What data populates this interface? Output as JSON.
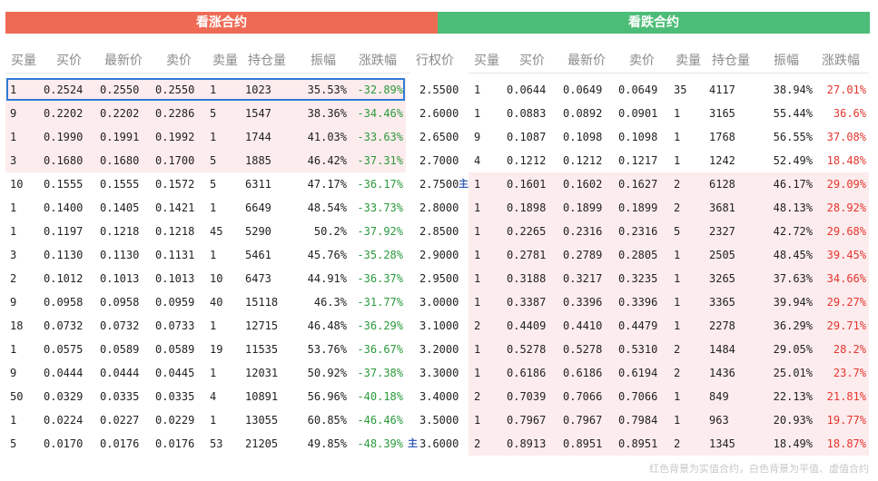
{
  "header": {
    "call_title": "看涨合约",
    "put_title": "看跌合约"
  },
  "columns": {
    "call": [
      "买量",
      "买价",
      "最新价",
      "卖价",
      "卖量",
      "持仓量",
      "振幅",
      "涨跌幅"
    ],
    "strike": "行权价",
    "put": [
      "买量",
      "买价",
      "最新价",
      "卖价",
      "卖量",
      "持仓量",
      "振幅",
      "涨跌幅"
    ]
  },
  "main_tag": "主",
  "footer_note": "红色背景为实值合约，白色背景为平值、虚值合约",
  "rows": [
    {
      "strike": "2.5500",
      "call": {
        "bid_vol": "1",
        "bid": "0.2524",
        "last": "0.2550",
        "ask": "0.2550",
        "ask_vol": "1",
        "oi": "1023",
        "amp": "35.53%",
        "chg": "-32.89%",
        "itm": true
      },
      "put": {
        "bid_vol": "1",
        "bid": "0.0644",
        "last": "0.0649",
        "ask": "0.0649",
        "ask_vol": "35",
        "oi": "4117",
        "amp": "38.94%",
        "chg": "27.01%",
        "itm": false
      }
    },
    {
      "strike": "2.6000",
      "call": {
        "bid_vol": "9",
        "bid": "0.2202",
        "last": "0.2202",
        "ask": "0.2286",
        "ask_vol": "5",
        "oi": "1547",
        "amp": "38.36%",
        "chg": "-34.46%",
        "itm": true
      },
      "put": {
        "bid_vol": "1",
        "bid": "0.0883",
        "last": "0.0892",
        "ask": "0.0901",
        "ask_vol": "1",
        "oi": "3165",
        "amp": "55.44%",
        "chg": "36.6%",
        "itm": false
      }
    },
    {
      "strike": "2.6500",
      "call": {
        "bid_vol": "1",
        "bid": "0.1990",
        "last": "0.1991",
        "ask": "0.1992",
        "ask_vol": "1",
        "oi": "1744",
        "amp": "41.03%",
        "chg": "-33.63%",
        "itm": true
      },
      "put": {
        "bid_vol": "9",
        "bid": "0.1087",
        "last": "0.1098",
        "ask": "0.1098",
        "ask_vol": "1",
        "oi": "1768",
        "amp": "56.55%",
        "chg": "37.08%",
        "itm": false
      }
    },
    {
      "strike": "2.7000",
      "call": {
        "bid_vol": "3",
        "bid": "0.1680",
        "last": "0.1680",
        "ask": "0.1700",
        "ask_vol": "5",
        "oi": "1885",
        "amp": "46.42%",
        "chg": "-37.31%",
        "itm": true
      },
      "put": {
        "bid_vol": "4",
        "bid": "0.1212",
        "last": "0.1212",
        "ask": "0.1217",
        "ask_vol": "1",
        "oi": "1242",
        "amp": "52.49%",
        "chg": "18.48%",
        "itm": false
      }
    },
    {
      "strike": "2.7500",
      "call": {
        "bid_vol": "10",
        "bid": "0.1555",
        "last": "0.1555",
        "ask": "0.1572",
        "ask_vol": "5",
        "oi": "6311",
        "amp": "47.17%",
        "chg": "-36.17%",
        "itm": false
      },
      "put": {
        "bid_vol": "1",
        "bid": "0.1601",
        "last": "0.1602",
        "ask": "0.1627",
        "ask_vol": "2",
        "oi": "6128",
        "amp": "46.17%",
        "chg": "29.09%",
        "itm": true
      }
    },
    {
      "strike": "2.8000",
      "call": {
        "bid_vol": "1",
        "bid": "0.1400",
        "last": "0.1405",
        "ask": "0.1421",
        "ask_vol": "1",
        "oi": "6649",
        "amp": "48.54%",
        "chg": "-33.73%",
        "itm": false
      },
      "put": {
        "bid_vol": "1",
        "bid": "0.1898",
        "last": "0.1899",
        "ask": "0.1899",
        "ask_vol": "2",
        "oi": "3681",
        "amp": "48.13%",
        "chg": "28.92%",
        "itm": true
      }
    },
    {
      "strike": "2.8500",
      "call": {
        "bid_vol": "1",
        "bid": "0.1197",
        "last": "0.1218",
        "ask": "0.1218",
        "ask_vol": "45",
        "oi": "5290",
        "amp": "50.2%",
        "chg": "-37.92%",
        "itm": false
      },
      "put": {
        "bid_vol": "1",
        "bid": "0.2265",
        "last": "0.2316",
        "ask": "0.2316",
        "ask_vol": "5",
        "oi": "2327",
        "amp": "42.72%",
        "chg": "29.68%",
        "itm": true
      }
    },
    {
      "strike": "2.9000",
      "call": {
        "bid_vol": "3",
        "bid": "0.1130",
        "last": "0.1130",
        "ask": "0.1131",
        "ask_vol": "1",
        "oi": "5461",
        "amp": "45.76%",
        "chg": "-35.28%",
        "itm": false
      },
      "put": {
        "bid_vol": "1",
        "bid": "0.2781",
        "last": "0.2789",
        "ask": "0.2805",
        "ask_vol": "1",
        "oi": "2505",
        "amp": "48.45%",
        "chg": "39.45%",
        "itm": true
      }
    },
    {
      "strike": "2.9500",
      "call": {
        "bid_vol": "2",
        "bid": "0.1012",
        "last": "0.1013",
        "ask": "0.1013",
        "ask_vol": "10",
        "oi": "6473",
        "amp": "44.91%",
        "chg": "-36.37%",
        "itm": false
      },
      "put": {
        "bid_vol": "1",
        "bid": "0.3188",
        "last": "0.3217",
        "ask": "0.3235",
        "ask_vol": "1",
        "oi": "3265",
        "amp": "37.63%",
        "chg": "34.66%",
        "itm": true
      }
    },
    {
      "strike": "3.0000",
      "call": {
        "bid_vol": "9",
        "bid": "0.0958",
        "last": "0.0958",
        "ask": "0.0959",
        "ask_vol": "40",
        "oi": "15118",
        "amp": "46.3%",
        "chg": "-31.77%",
        "itm": false
      },
      "put": {
        "bid_vol": "1",
        "bid": "0.3387",
        "last": "0.3396",
        "ask": "0.3396",
        "ask_vol": "1",
        "oi": "3365",
        "amp": "39.94%",
        "chg": "29.27%",
        "itm": true
      }
    },
    {
      "strike": "3.1000",
      "call": {
        "bid_vol": "18",
        "bid": "0.0732",
        "last": "0.0732",
        "ask": "0.0733",
        "ask_vol": "1",
        "oi": "12715",
        "amp": "46.48%",
        "chg": "-36.29%",
        "itm": false
      },
      "put": {
        "bid_vol": "2",
        "bid": "0.4409",
        "last": "0.4410",
        "ask": "0.4479",
        "ask_vol": "1",
        "oi": "2278",
        "amp": "36.29%",
        "chg": "29.71%",
        "itm": true
      }
    },
    {
      "strike": "3.2000",
      "call": {
        "bid_vol": "1",
        "bid": "0.0575",
        "last": "0.0589",
        "ask": "0.0589",
        "ask_vol": "19",
        "oi": "11535",
        "amp": "53.76%",
        "chg": "-36.67%",
        "itm": false
      },
      "put": {
        "bid_vol": "1",
        "bid": "0.5278",
        "last": "0.5278",
        "ask": "0.5310",
        "ask_vol": "2",
        "oi": "1484",
        "amp": "29.05%",
        "chg": "28.2%",
        "itm": true
      }
    },
    {
      "strike": "3.3000",
      "call": {
        "bid_vol": "9",
        "bid": "0.0444",
        "last": "0.0444",
        "ask": "0.0445",
        "ask_vol": "1",
        "oi": "12031",
        "amp": "50.92%",
        "chg": "-37.38%",
        "itm": false
      },
      "put": {
        "bid_vol": "1",
        "bid": "0.6186",
        "last": "0.6186",
        "ask": "0.6194",
        "ask_vol": "2",
        "oi": "1436",
        "amp": "25.01%",
        "chg": "23.7%",
        "itm": true
      }
    },
    {
      "strike": "3.4000",
      "call": {
        "bid_vol": "50",
        "bid": "0.0329",
        "last": "0.0335",
        "ask": "0.0335",
        "ask_vol": "4",
        "oi": "10891",
        "amp": "56.96%",
        "chg": "-40.18%",
        "itm": false
      },
      "put": {
        "bid_vol": "2",
        "bid": "0.7039",
        "last": "0.7066",
        "ask": "0.7066",
        "ask_vol": "1",
        "oi": "849",
        "amp": "22.13%",
        "chg": "21.81%",
        "itm": true
      }
    },
    {
      "strike": "3.5000",
      "call": {
        "bid_vol": "1",
        "bid": "0.0224",
        "last": "0.0227",
        "ask": "0.0229",
        "ask_vol": "1",
        "oi": "13055",
        "amp": "60.85%",
        "chg": "-46.46%",
        "itm": false
      },
      "put": {
        "bid_vol": "1",
        "bid": "0.7967",
        "last": "0.7967",
        "ask": "0.7984",
        "ask_vol": "1",
        "oi": "963",
        "amp": "20.93%",
        "chg": "19.77%",
        "itm": true
      }
    },
    {
      "strike": "3.6000",
      "call": {
        "bid_vol": "5",
        "bid": "0.0170",
        "last": "0.0176",
        "ask": "0.0176",
        "ask_vol": "53",
        "oi": "21205",
        "amp": "49.85%",
        "chg": "-48.39%",
        "itm": false
      },
      "put": {
        "bid_vol": "2",
        "bid": "0.8913",
        "last": "0.8951",
        "ask": "0.8951",
        "ask_vol": "2",
        "oi": "1345",
        "amp": "18.49%",
        "chg": "18.87%",
        "itm": true
      }
    }
  ],
  "main_rows": [
    {
      "row": 4,
      "side": "put"
    },
    {
      "row": 15,
      "side": "call"
    }
  ],
  "colors": {
    "call_banner": "#ef6a55",
    "put_banner": "#4cbd78",
    "itm_bg": "#fdeced",
    "neg": "#2a9a3c",
    "pos": "#e5352e",
    "selection": "#2f7bd6"
  }
}
